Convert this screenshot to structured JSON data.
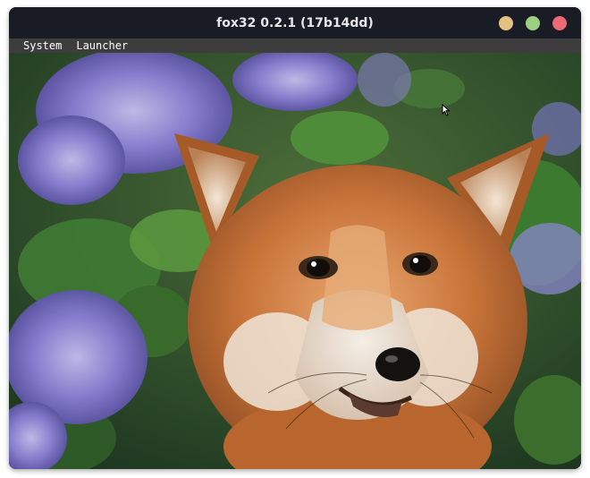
{
  "window": {
    "title": "fox32 0.2.1 (17b14dd)",
    "buttons": {
      "minimize": "#e3c281",
      "maximize": "#9bd17e",
      "close": "#ec6a74"
    }
  },
  "menubar": {
    "items": [
      {
        "label": "System"
      },
      {
        "label": "Launcher"
      }
    ]
  },
  "desktop": {
    "wallpaper": "red fox among purple lilac flowers",
    "cursor_icon": "arrow-cursor-icon"
  }
}
